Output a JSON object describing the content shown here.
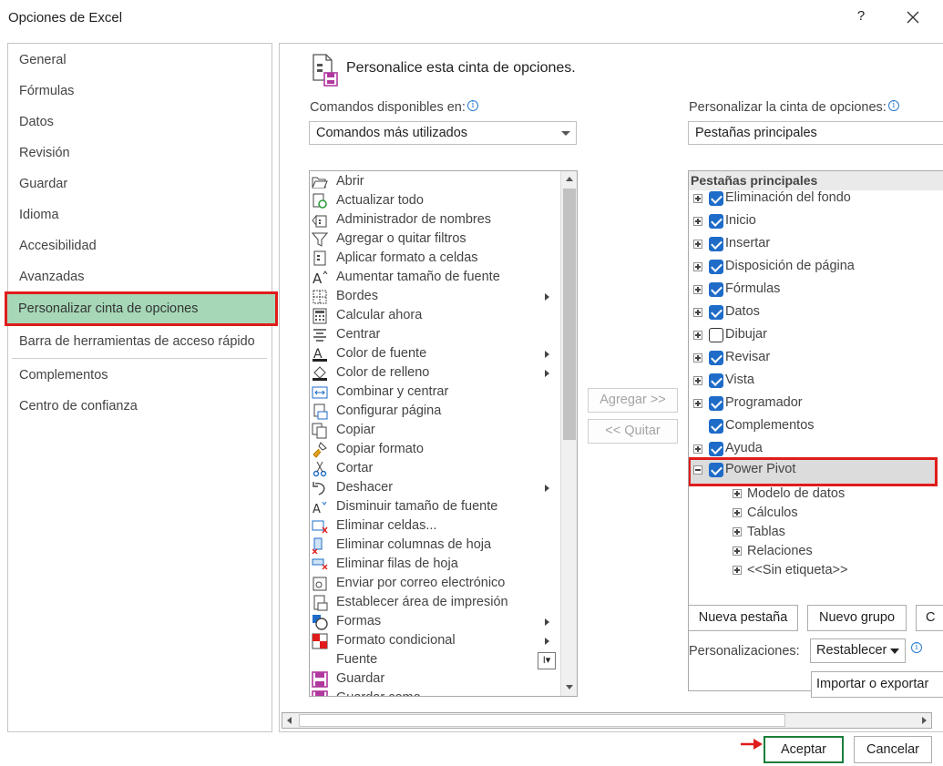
{
  "window": {
    "title": "Opciones de Excel",
    "help": "?"
  },
  "nav": {
    "items": [
      {
        "label": "General"
      },
      {
        "label": "Fórmulas"
      },
      {
        "label": "Datos"
      },
      {
        "label": "Revisión"
      },
      {
        "label": "Guardar"
      },
      {
        "label": "Idioma"
      },
      {
        "label": "Accesibilidad"
      },
      {
        "label": "Avanzadas"
      },
      {
        "label": "Personalizar cinta de opciones"
      },
      {
        "label": "Barra de herramientas de acceso rápido"
      },
      {
        "label": "Complementos"
      },
      {
        "label": "Centro de confianza"
      }
    ],
    "selected": "Personalizar cinta de opciones"
  },
  "content": {
    "heading": "Personalice esta cinta de opciones.",
    "commands_label": "Comandos disponibles en:",
    "commands_select": "Comandos más utilizados",
    "ribbon_label": "Personalizar la cinta de opciones:",
    "ribbon_select": "Pestañas principales",
    "commands": [
      {
        "label": "Abrir",
        "icon": "folder-open-icon"
      },
      {
        "label": "Actualizar todo",
        "icon": "refresh-all-icon"
      },
      {
        "label": "Administrador de nombres",
        "icon": "name-manager-icon"
      },
      {
        "label": "Agregar o quitar filtros",
        "icon": "filter-icon"
      },
      {
        "label": "Aplicar formato a celdas",
        "icon": "format-cells-icon"
      },
      {
        "label": "Aumentar tamaño de fuente",
        "icon": "font-grow-icon"
      },
      {
        "label": "Bordes",
        "icon": "borders-icon",
        "submenu": true
      },
      {
        "label": "Calcular ahora",
        "icon": "calculator-icon"
      },
      {
        "label": "Centrar",
        "icon": "align-center-icon"
      },
      {
        "label": "Color de fuente",
        "icon": "font-color-icon",
        "submenu": true
      },
      {
        "label": "Color de relleno",
        "icon": "fill-color-icon",
        "submenu": true
      },
      {
        "label": "Combinar y centrar",
        "icon": "merge-center-icon"
      },
      {
        "label": "Configurar página",
        "icon": "page-setup-icon"
      },
      {
        "label": "Copiar",
        "icon": "copy-icon"
      },
      {
        "label": "Copiar formato",
        "icon": "format-painter-icon"
      },
      {
        "label": "Cortar",
        "icon": "scissors-icon"
      },
      {
        "label": "Deshacer",
        "icon": "undo-icon",
        "submenu": true
      },
      {
        "label": "Disminuir tamaño de fuente",
        "icon": "font-shrink-icon"
      },
      {
        "label": "Eliminar celdas...",
        "icon": "delete-cells-icon"
      },
      {
        "label": "Eliminar columnas de hoja",
        "icon": "delete-columns-icon"
      },
      {
        "label": "Eliminar filas de hoja",
        "icon": "delete-rows-icon"
      },
      {
        "label": "Enviar por correo electrónico",
        "icon": "email-icon"
      },
      {
        "label": "Establecer área de impresión",
        "icon": "print-area-icon"
      },
      {
        "label": "Formas",
        "icon": "shapes-icon",
        "submenu": true
      },
      {
        "label": "Formato condicional",
        "icon": "conditional-format-icon",
        "submenu": true
      },
      {
        "label": "Fuente",
        "icon": "",
        "ibeam": true
      },
      {
        "label": "Guardar",
        "icon": "save-icon"
      },
      {
        "label": "Guardar como",
        "icon": "save-as-icon"
      }
    ],
    "add_button": "Agregar >>",
    "remove_button": "<< Quitar",
    "tree_header": "Pestañas principales",
    "tabs": [
      {
        "label": "Eliminación del fondo",
        "checked": true,
        "expander": "plus"
      },
      {
        "label": "Inicio",
        "checked": true,
        "expander": "plus"
      },
      {
        "label": "Insertar",
        "checked": true,
        "expander": "plus"
      },
      {
        "label": "Disposición de página",
        "checked": true,
        "expander": "plus"
      },
      {
        "label": "Fórmulas",
        "checked": true,
        "expander": "plus"
      },
      {
        "label": "Datos",
        "checked": true,
        "expander": "plus"
      },
      {
        "label": "Dibujar",
        "checked": false,
        "expander": "plus"
      },
      {
        "label": "Revisar",
        "checked": true,
        "expander": "plus"
      },
      {
        "label": "Vista",
        "checked": true,
        "expander": "plus"
      },
      {
        "label": "Programador",
        "checked": true,
        "expander": "plus"
      },
      {
        "label": "Complementos",
        "checked": true,
        "expander": "none"
      },
      {
        "label": "Ayuda",
        "checked": true,
        "expander": "plus"
      },
      {
        "label": "Power Pivot",
        "checked": true,
        "expander": "minus"
      }
    ],
    "groups": [
      {
        "label": "Modelo de datos"
      },
      {
        "label": "Cálculos"
      },
      {
        "label": "Tablas"
      },
      {
        "label": "Relaciones"
      },
      {
        "label": "<<Sin etiqueta>>"
      }
    ],
    "new_tab_button": "Nueva pestaña",
    "new_group_button": "Nuevo grupo",
    "rename_button_partial": "C",
    "customizations_label": "Personalizaciones:",
    "reset_button": "Restablecer",
    "import_export_button": "Importar o exportar"
  },
  "footer": {
    "ok": "Aceptar",
    "cancel": "Cancelar"
  },
  "colors": {
    "accent_check": "#1e6cc8",
    "selected_nav": "#a6d8b8",
    "highlight_outline": "#e01c1c",
    "ok_border": "#1a7d3a"
  }
}
